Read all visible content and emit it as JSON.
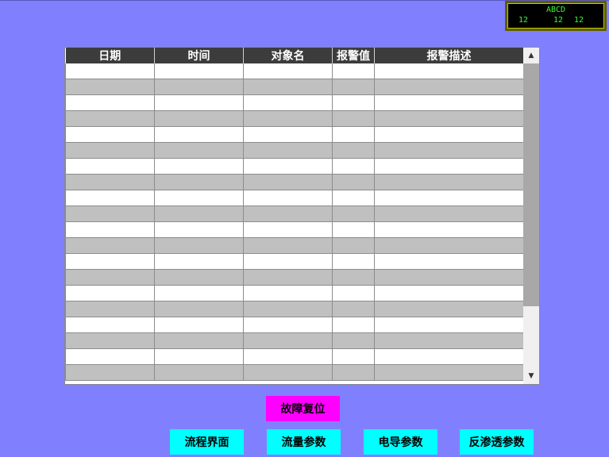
{
  "status": {
    "title": "ABCD",
    "values": [
      "12",
      "12",
      "12"
    ]
  },
  "table": {
    "columns": [
      "日期",
      "时间",
      "对象名",
      "报警值",
      "报警描述"
    ],
    "row_count": 20
  },
  "buttons": {
    "reset": "故障复位",
    "nav": [
      "流程界面",
      "流量参数",
      "电导参数",
      "反渗透参数"
    ]
  },
  "colors": {
    "background": "#8080ff",
    "header": "#3c3c3c",
    "row_alt": "#c0c0c0",
    "reset_button": "#ff00ff",
    "nav_button": "#00ffff",
    "status_text": "#33ff33"
  },
  "icons": {
    "scroll_up": "chevron-up-icon",
    "scroll_down": "chevron-down-icon"
  }
}
